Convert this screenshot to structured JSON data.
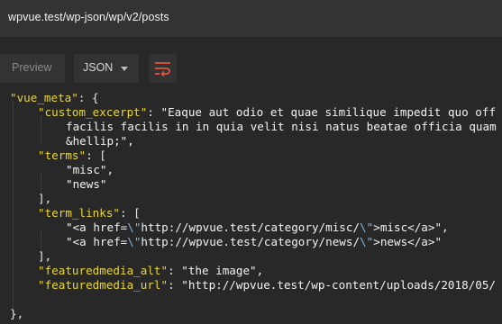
{
  "url": "wpvue.test/wp-json/wp/v2/posts",
  "toolbar": {
    "preview_label": "Preview",
    "format_label": "JSON",
    "wrap_icon": "wrap-lines-icon"
  },
  "colors": {
    "key": "#e8d63c",
    "string": "#f2f2f2",
    "escape": "#7fb6e0",
    "wrap_icon": "#e2553f",
    "background": "#282828"
  },
  "code": {
    "vue_meta": "\"vue_meta\"",
    "vue_meta_p": ": {",
    "custom_excerpt": "\"custom_excerpt\"",
    "custom_excerpt_p": ": ",
    "excerpt_1": "\"Eaque aut odio et quae similique impedit quo off",
    "excerpt_2": "facilis facilis in in quia velit nisi natus beatae officia quam",
    "excerpt_3": "&hellip;\",",
    "terms": "\"terms\"",
    "terms_p": ": [",
    "term_1": "\"misc\",",
    "term_2": "\"news\"",
    "close_arr_1": "],",
    "term_links": "\"term_links\"",
    "term_links_p": ": [",
    "link1_a": "\"<a href=",
    "link1_esc1": "\\\"",
    "link1_b": "http://wpvue.test/category/misc/",
    "link1_esc2": "\\\"",
    "link1_c": ">misc</a>\",",
    "link2_a": "\"<a href=",
    "link2_esc1": "\\\"",
    "link2_b": "http://wpvue.test/category/news/",
    "link2_esc2": "\\\"",
    "link2_c": ">news</a>\"",
    "close_arr_2": "],",
    "fm_alt": "\"featuredmedia_alt\"",
    "fm_alt_p": ": ",
    "fm_alt_v": "\"the image\",",
    "fm_url": "\"featuredmedia_url\"",
    "fm_url_p": ": ",
    "fm_url_v": "\"http://wpvue.test/wp-content/uploads/2018/05/",
    "close_obj": "},"
  }
}
